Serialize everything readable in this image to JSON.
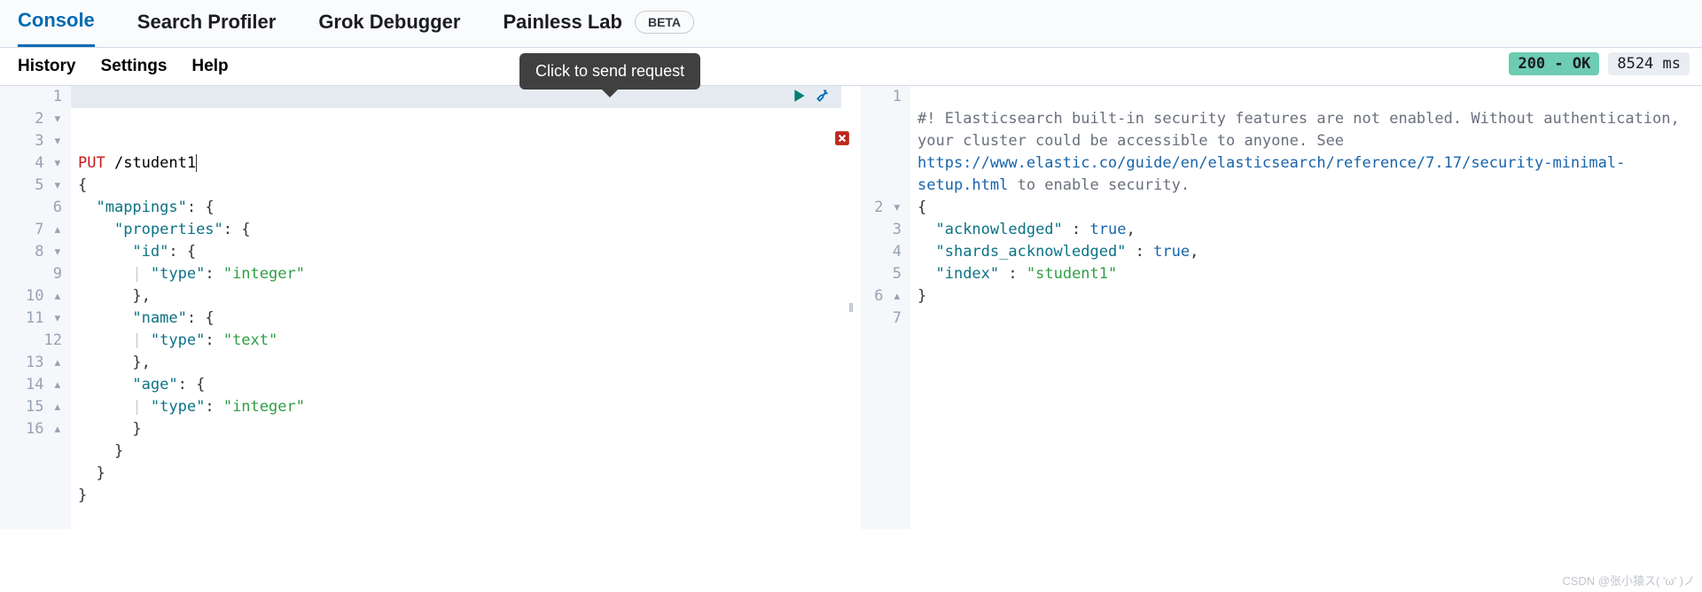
{
  "tabs": {
    "console": "Console",
    "profiler": "Search Profiler",
    "grok": "Grok Debugger",
    "painless": "Painless Lab",
    "beta": "BETA"
  },
  "subnav": {
    "history": "History",
    "settings": "Settings",
    "help": "Help"
  },
  "tooltip": "Click to send request",
  "status": {
    "code": "200 - OK",
    "time": "8524 ms"
  },
  "request": {
    "method": "PUT",
    "path": "/student1",
    "lines": [
      {
        "n": "1",
        "fold": ""
      },
      {
        "n": "2",
        "fold": "▾"
      },
      {
        "n": "3",
        "fold": "▾"
      },
      {
        "n": "4",
        "fold": "▾"
      },
      {
        "n": "5",
        "fold": "▾"
      },
      {
        "n": "6",
        "fold": ""
      },
      {
        "n": "7",
        "fold": "▴"
      },
      {
        "n": "8",
        "fold": "▾"
      },
      {
        "n": "9",
        "fold": ""
      },
      {
        "n": "10",
        "fold": "▴"
      },
      {
        "n": "11",
        "fold": "▾"
      },
      {
        "n": "12",
        "fold": ""
      },
      {
        "n": "13",
        "fold": "▴"
      },
      {
        "n": "14",
        "fold": "▴"
      },
      {
        "n": "15",
        "fold": "▴"
      },
      {
        "n": "16",
        "fold": "▴"
      }
    ],
    "body": {
      "mappings": {
        "properties": {
          "id": {
            "type": "integer"
          },
          "name": {
            "type": "text"
          },
          "age": {
            "type": "integer"
          }
        }
      }
    },
    "keys": {
      "mappings": "\"mappings\"",
      "properties": "\"properties\"",
      "id": "\"id\"",
      "name": "\"name\"",
      "age": "\"age\"",
      "type": "\"type\"",
      "integer": "\"integer\"",
      "text": "\"text\""
    }
  },
  "response": {
    "lines": [
      {
        "n": "1",
        "fold": ""
      },
      {
        "n": "2",
        "fold": "▾"
      },
      {
        "n": "3",
        "fold": ""
      },
      {
        "n": "4",
        "fold": ""
      },
      {
        "n": "5",
        "fold": ""
      },
      {
        "n": "6",
        "fold": "▴"
      },
      {
        "n": "7",
        "fold": ""
      }
    ],
    "warning_prefix": "#! ",
    "warning_text": "Elasticsearch built-in security features are not enabled. Without authentication, your cluster could be accessible to anyone. See ",
    "warning_url": "https://www.elastic.co/guide/en/elasticsearch/reference/7.17/security-minimal-setup.html",
    "warning_suffix": " to enable security.",
    "body": {
      "acknowledged": true,
      "shards_acknowledged": true,
      "index": "student1"
    },
    "keys": {
      "ack": "\"acknowledged\"",
      "sack": "\"shards_acknowledged\"",
      "index": "\"index\"",
      "true": "true",
      "student1": "\"student1\""
    }
  },
  "watermark": "CSDN @张小猿ス( 'ω' )ノ"
}
